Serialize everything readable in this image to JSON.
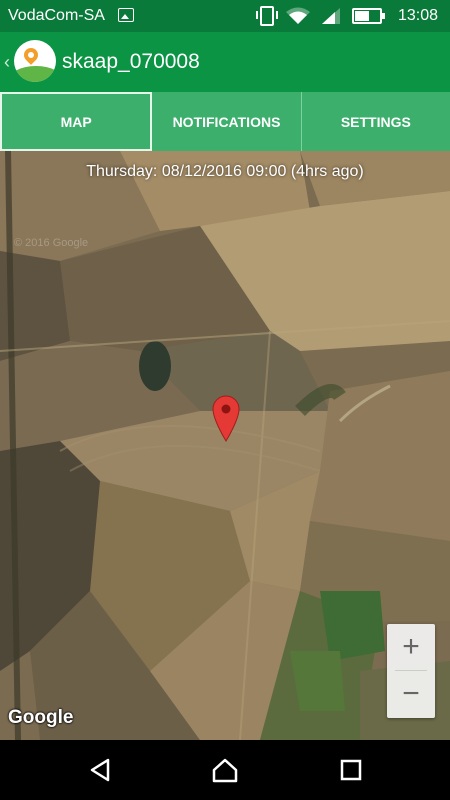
{
  "status_bar": {
    "carrier": "VodaCom-SA",
    "time": "13:08",
    "icons": [
      "picture-icon",
      "vibrate-icon",
      "wifi-icon",
      "signal-icon",
      "battery-charging-icon"
    ]
  },
  "app_bar": {
    "title": "skaap_070008",
    "back_icon": "chevron-left-icon",
    "logo": "app-logo"
  },
  "tabs": [
    {
      "label": "MAP",
      "active": true
    },
    {
      "label": "NOTIFICATIONS",
      "active": false
    },
    {
      "label": "SETTINGS",
      "active": false
    }
  ],
  "map": {
    "timestamp": "Thursday: 08/12/2016 09:00 (4hrs ago)",
    "type": "satellite",
    "marker_icon": "map-pin-icon",
    "zoom_in": "+",
    "zoom_out": "−",
    "attribution": "Google",
    "watermark": "© 2016 Google"
  },
  "nav_bar": {
    "icons": [
      "back-triangle-icon",
      "home-icon",
      "recents-square-icon"
    ]
  },
  "colors": {
    "status_bar": "#0a7a3a",
    "app_bar": "#0b9444",
    "tabs": "#3daf6c",
    "marker": "#e53935"
  }
}
